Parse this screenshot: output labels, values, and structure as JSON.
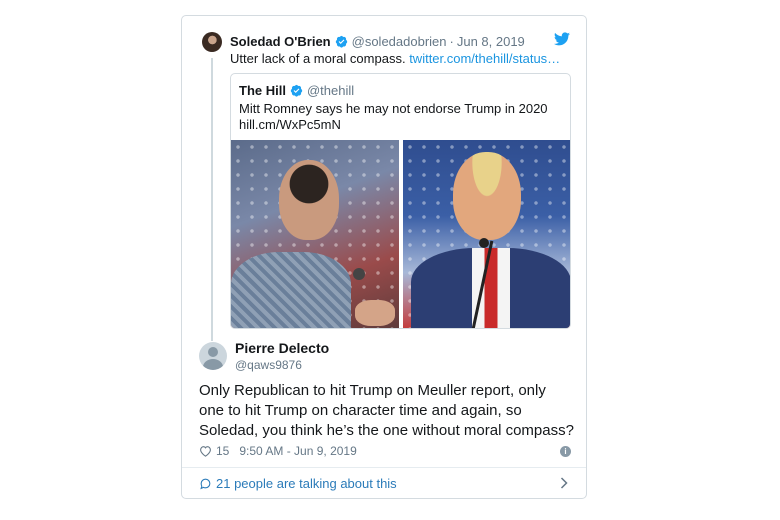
{
  "parent_tweet": {
    "name": "Soledad O'Brien",
    "handle": "@soledadobrien",
    "separator": "·",
    "date": "Jun 8, 2019",
    "text": "Utter lack of a moral compass.",
    "link": "twitter.com/thehill/status…",
    "verified_icon": "verified-badge-icon",
    "brand_icon": "twitter-bird-icon"
  },
  "quoted_tweet": {
    "name": "The Hill",
    "handle": "@thehill",
    "text_line1": "Mitt Romney says he may not endorse Trump in 2020",
    "text_line2": "hill.cm/WxPc5mN"
  },
  "reply": {
    "name": "Pierre Delecto",
    "handle": "@qaws9876",
    "text": "Only Republican to hit Trump on Meuller report, only one to hit Trump on character time and again, so Soledad, you think he’s the one without moral compass?",
    "likes": "15",
    "timestamp": "9:50 AM - Jun 9, 2019"
  },
  "footer": {
    "talking_label": "21 people are talking about this"
  },
  "colors": {
    "link": "#1b95e0",
    "verified": "#1da1f2",
    "muted": "#657786",
    "footer_link": "#2b7bb9"
  }
}
